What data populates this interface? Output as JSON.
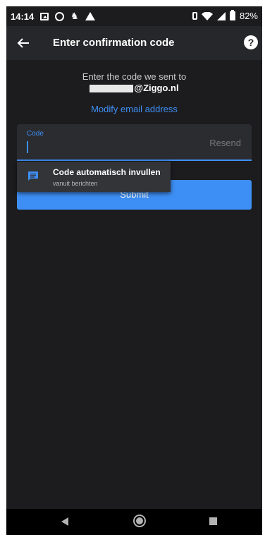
{
  "status_bar": {
    "time": "14:14",
    "battery": "82%",
    "icons": [
      "image-icon",
      "circle-icon",
      "android-icon",
      "warning-icon",
      "vibrate-icon",
      "wifi-icon",
      "signal-icon",
      "battery-icon"
    ]
  },
  "app_bar": {
    "title": "Enter confirmation code",
    "help": "?"
  },
  "content": {
    "instruction": "Enter the code we sent to",
    "email_suffix": "@Ziggo.nl",
    "modify_link": "Modify email address",
    "code_label": "Code",
    "resend": "Resend",
    "submit": "Submit"
  },
  "autofill": {
    "title": "Code automatisch invullen",
    "subtitle": "vanuit berichten"
  },
  "colors": {
    "background": "#1c1c1e",
    "accent": "#3e8ff5",
    "app_bar": "#26272a"
  }
}
